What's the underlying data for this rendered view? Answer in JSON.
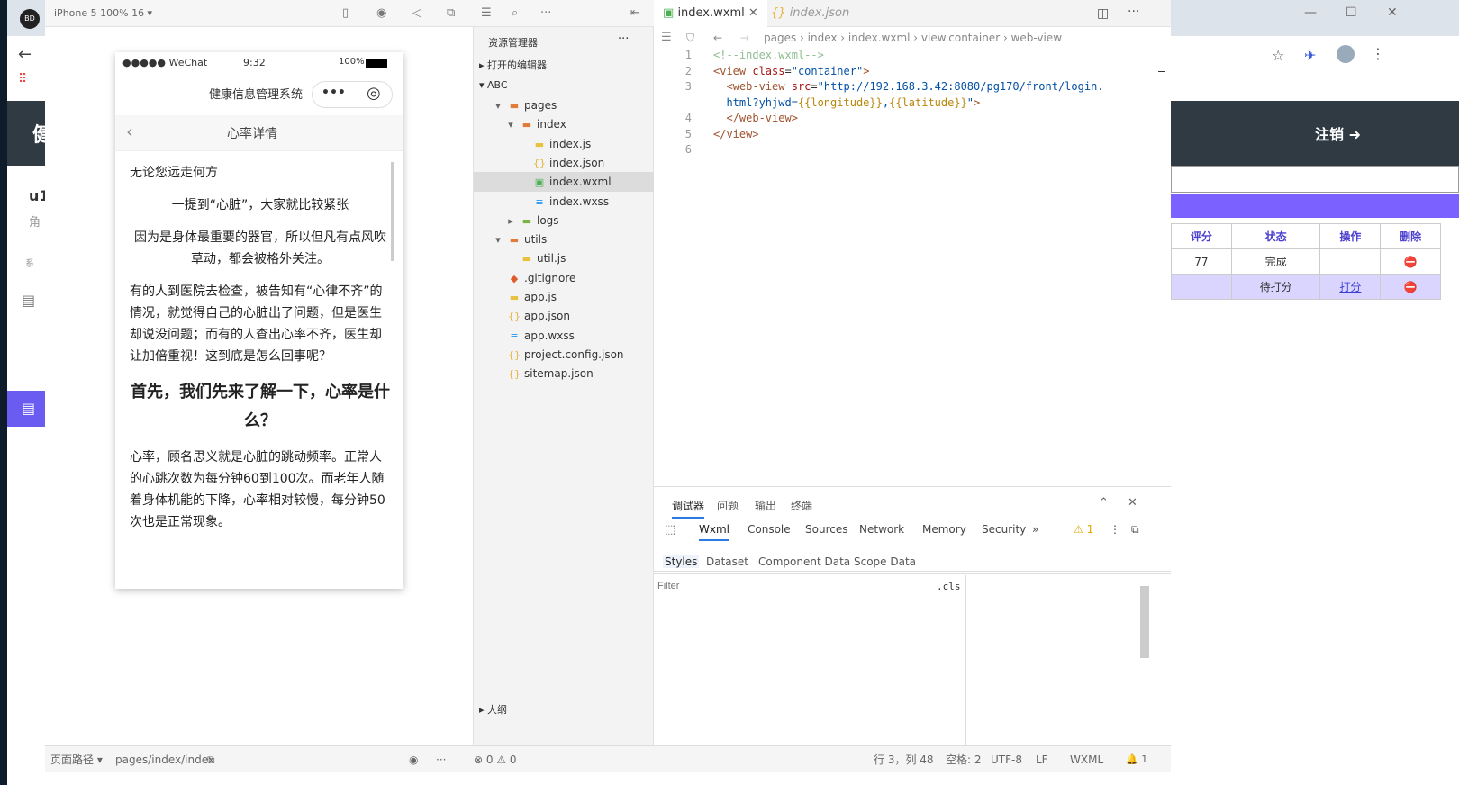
{
  "browser": {
    "logo": "BD",
    "back_icon": "arrow-left-icon",
    "logout": "注销",
    "side_partial": "u1",
    "side_sub": "角",
    "side_sub2": "系",
    "header_partial": "健",
    "table": {
      "headers": [
        "评分",
        "状态",
        "操作",
        "删除"
      ],
      "rows": [
        {
          "score": "77",
          "status": "完成",
          "action": "",
          "delete": "⛔"
        },
        {
          "score": "",
          "status": "待打分",
          "action": "打分",
          "delete": "⛔"
        }
      ]
    }
  },
  "ide": {
    "device": "iPhone 5 100% 16 ▾",
    "sim": {
      "status_carrier": "●●●●● WeChat",
      "status_time": "9:32",
      "status_battery": "100%",
      "app_title": "健康信息管理系统",
      "page_title": "心率详情",
      "paragraphs": [
        {
          "text": "无论您远走何方",
          "style": ""
        },
        {
          "text": "一提到“心脏”，大家就比较紧张",
          "style": "c"
        },
        {
          "text": "因为是身体最重要的器官，所以但凡有点风吹草动，都会被格外关注。",
          "style": "c"
        },
        {
          "text": "有的人到医院去检查，被告知有“心律不齐”的情况，就觉得自己的心脏出了问题，但是医生却说没问题；而有的人查出心率不齐，医生却让加倍重视！这到底是怎么回事呢？",
          "style": ""
        },
        {
          "text": "首先，我们先来了解一下，心率是什么？",
          "style": "h"
        },
        {
          "text": "心率，顾名思义就是心脏的跳动频率。正常人的心跳次数为每分钟60到100次。而老年人随着身体机能的下降，心率相对较慢，每分钟50次也是正常现象。",
          "style": ""
        }
      ]
    },
    "explorer": {
      "title": "资源管理器",
      "more": "···",
      "open_editors": "打开的编辑器",
      "project": "ABC",
      "outline": "大纲",
      "tree": [
        {
          "label": "pages",
          "depth": 1,
          "type": "folder-open",
          "arrow": "▾"
        },
        {
          "label": "index",
          "depth": 2,
          "type": "folder-open",
          "arrow": "▾"
        },
        {
          "label": "index.js",
          "depth": 3,
          "type": "js"
        },
        {
          "label": "index.json",
          "depth": 3,
          "type": "json"
        },
        {
          "label": "index.wxml",
          "depth": 3,
          "type": "wxml",
          "selected": true
        },
        {
          "label": "index.wxss",
          "depth": 3,
          "type": "wxss"
        },
        {
          "label": "logs",
          "depth": 2,
          "type": "folder",
          "arrow": "▸"
        },
        {
          "label": "utils",
          "depth": 1,
          "type": "folder-open",
          "arrow": "▾"
        },
        {
          "label": "util.js",
          "depth": 2,
          "type": "js"
        },
        {
          "label": ".gitignore",
          "depth": 1,
          "type": "git"
        },
        {
          "label": "app.js",
          "depth": 1,
          "type": "js"
        },
        {
          "label": "app.json",
          "depth": 1,
          "type": "json"
        },
        {
          "label": "app.wxss",
          "depth": 1,
          "type": "wxss"
        },
        {
          "label": "project.config.json",
          "depth": 1,
          "type": "json"
        },
        {
          "label": "sitemap.json",
          "depth": 1,
          "type": "json"
        }
      ]
    },
    "editor": {
      "tabs": [
        {
          "label": "index.wxml",
          "active": true
        },
        {
          "label": "index.json",
          "active": false
        }
      ],
      "breadcrumb": [
        "pages",
        "index",
        "index.wxml",
        "view.container",
        "web-view"
      ],
      "lines": [
        {
          "n": "1",
          "html": "<span class='cm'>&lt;!--index.wxml--&gt;</span>"
        },
        {
          "n": "2",
          "html": "<span class='tg'>&lt;view</span> <span class='at'>class</span>=<span class='st'>\"container\"</span><span class='tg'>&gt;</span>"
        },
        {
          "n": "3",
          "html": "  <span class='tg'>&lt;web-view</span> <span class='at'>src</span>=<span class='st'>\"http://192.168.3.42:8080/pg170/front/login.</span>"
        },
        {
          "n": "",
          "html": "  <span class='st'>html?yhjwd=</span><span class='br'>{{longitude}}</span><span class='st'>,</span><span class='br'>{{latitude}}</span><span class='st'>\"</span><span class='tg'>&gt;</span>"
        },
        {
          "n": "4",
          "html": "  <span class='tg'>&lt;/web-view&gt;</span>"
        },
        {
          "n": "5",
          "html": "<span class='tg'>&lt;/view&gt;</span>"
        },
        {
          "n": "6",
          "html": ""
        }
      ]
    },
    "devtools": {
      "top_tabs": [
        "调试器",
        "问题",
        "输出",
        "终端"
      ],
      "tabs": [
        "Wxml",
        "Console",
        "Sources",
        "Network",
        "Memory",
        "Security"
      ],
      "more": "»",
      "warn": "⚠ 1",
      "sub_tabs": [
        "Styles",
        "Dataset",
        "Component Data",
        "Scope Data"
      ],
      "filter_placeholder": "Filter",
      "cls": ".cls"
    },
    "status": {
      "path_label": "页面路径 ▾",
      "path": "pages/index/index",
      "errors": "⊗ 0 ⚠ 0",
      "pos": "行 3，列 48",
      "spaces": "空格: 2",
      "enc": "UTF-8",
      "eol": "LF",
      "lang": "WXML",
      "bell": "🔔 1"
    }
  }
}
